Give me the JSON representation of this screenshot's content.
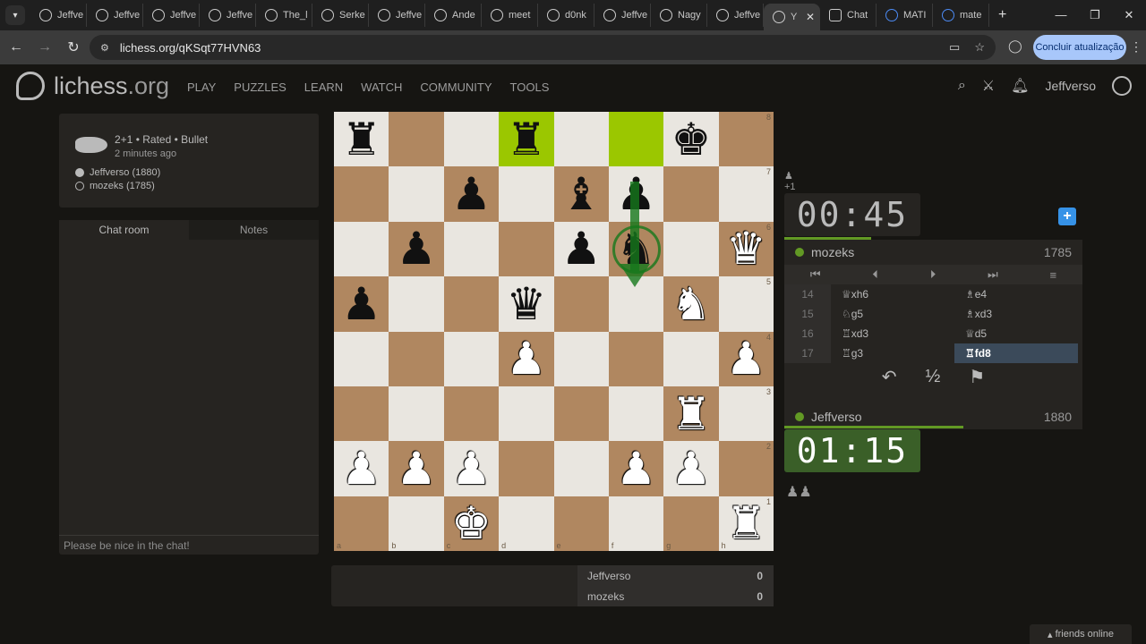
{
  "browser": {
    "tabs": [
      "Jeffve",
      "Jeffve",
      "Jeffve",
      "Jeffve",
      "The_l",
      "Serke",
      "Jeffve",
      "Ande",
      "meet",
      "d0nk",
      "Jeffve",
      "Nagy",
      "Jeffve",
      "Y",
      "Chat",
      "MATI",
      "mate"
    ],
    "url": "lichess.org/qKSqt77HVN63",
    "update_label": "Concluir atualização"
  },
  "site": {
    "logo_main": "lichess",
    "logo_org": ".org",
    "nav": [
      "PLAY",
      "PUZZLES",
      "LEARN",
      "WATCH",
      "COMMUNITY",
      "TOOLS"
    ],
    "username": "Jeffverso"
  },
  "game_info": {
    "meta": "2+1 • Rated • Bullet",
    "time_ago": "2 minutes ago",
    "white_player": "Jeffverso (1880)",
    "black_player": "mozeks (1785)"
  },
  "chat": {
    "tab_chat": "Chat room",
    "tab_notes": "Notes",
    "placeholder": "Please be nice in the chat!"
  },
  "board": {
    "ranks": [
      "8",
      "7",
      "6",
      "5",
      "4",
      "3",
      "2",
      "1"
    ],
    "files": [
      "a",
      "b",
      "c",
      "d",
      "e",
      "f",
      "g",
      "h"
    ],
    "rows": [
      [
        "br",
        "",
        "",
        "br",
        "",
        "",
        "bk",
        ""
      ],
      [
        "",
        "",
        "bp",
        "",
        "bb",
        "bp",
        "",
        ""
      ],
      [
        "",
        "bp",
        "",
        "",
        "bp",
        "bn",
        "",
        "wq"
      ],
      [
        "bp",
        "",
        "",
        "bq",
        "",
        "",
        "wn",
        ""
      ],
      [
        "",
        "",
        "",
        "wp",
        "",
        "",
        "",
        "wp"
      ],
      [
        "",
        "",
        "",
        "",
        "",
        "",
        "wr",
        ""
      ],
      [
        "wp",
        "wp",
        "wp",
        "",
        "",
        "wp",
        "wp",
        ""
      ],
      [
        "",
        "",
        "wk",
        "",
        "",
        "",
        "",
        "wr"
      ]
    ],
    "highlight": [
      "d8",
      "f8"
    ]
  },
  "opponent": {
    "spectators": "+1",
    "clock": "00:45",
    "time_fraction": 0.4,
    "name": "mozeks",
    "rating": "1785"
  },
  "moves": [
    {
      "n": "14",
      "w": "♕xh6",
      "b": "♗e4"
    },
    {
      "n": "15",
      "w": "♘g5",
      "b": "♗xd3"
    },
    {
      "n": "16",
      "w": "♖xd3",
      "b": "♕d5"
    },
    {
      "n": "17",
      "w": "♖g3",
      "b": "♖fd8"
    }
  ],
  "controls": [
    "⏮",
    "⏴",
    "⏵",
    "⏭",
    "≡"
  ],
  "actions": [
    "↶",
    "½",
    "⚑"
  ],
  "me": {
    "name": "Jeffverso",
    "rating": "1880",
    "clock": "01:15",
    "time_fraction": 0.6
  },
  "score": [
    {
      "name": "Jeffverso",
      "score": "0"
    },
    {
      "name": "mozeks",
      "score": "0"
    }
  ],
  "friends_online": "friends online"
}
